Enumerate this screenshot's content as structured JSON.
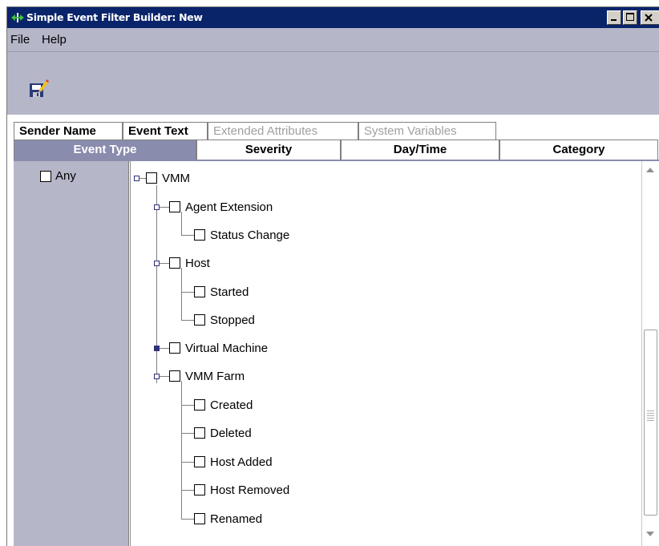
{
  "window": {
    "title": "Simple Event Filter Builder: New",
    "controls": {
      "minimize": "_",
      "maximize": "□",
      "close": "✕"
    },
    "colors": {
      "titlebar": "#0a246a",
      "panel": "#b5b6c8",
      "tab_selected": "#8a8cae",
      "handle": "#30307a"
    }
  },
  "menubar": {
    "items": [
      {
        "label": "File"
      },
      {
        "label": "Help"
      }
    ]
  },
  "toolbar": {
    "save_icon": "save-edit-icon"
  },
  "tabs_row1": [
    {
      "label": "Sender Name",
      "enabled": true
    },
    {
      "label": "Event Text",
      "enabled": true
    },
    {
      "label": "Extended Attributes",
      "enabled": false
    },
    {
      "label": "System Variables",
      "enabled": false
    }
  ],
  "tabs_row2": [
    {
      "label": "Event Type",
      "selected": true
    },
    {
      "label": "Severity",
      "selected": false
    },
    {
      "label": "Day/Time",
      "selected": false
    },
    {
      "label": "Category",
      "selected": false
    }
  ],
  "left_panel": {
    "any_label": "Any",
    "any_checked": false
  },
  "tree": {
    "nodes": [
      {
        "label": "VMM",
        "checked": false
      },
      {
        "label": "Agent Extension",
        "checked": false
      },
      {
        "label": "Status Change",
        "checked": false
      },
      {
        "label": "Host",
        "checked": false
      },
      {
        "label": "Started",
        "checked": false
      },
      {
        "label": "Stopped",
        "checked": false
      },
      {
        "label": "Virtual Machine",
        "checked": false
      },
      {
        "label": "VMM Farm",
        "checked": false
      },
      {
        "label": "Created",
        "checked": false
      },
      {
        "label": "Deleted",
        "checked": false
      },
      {
        "label": "Host Added",
        "checked": false
      },
      {
        "label": "Host Removed",
        "checked": false
      },
      {
        "label": "Renamed",
        "checked": false
      }
    ]
  }
}
